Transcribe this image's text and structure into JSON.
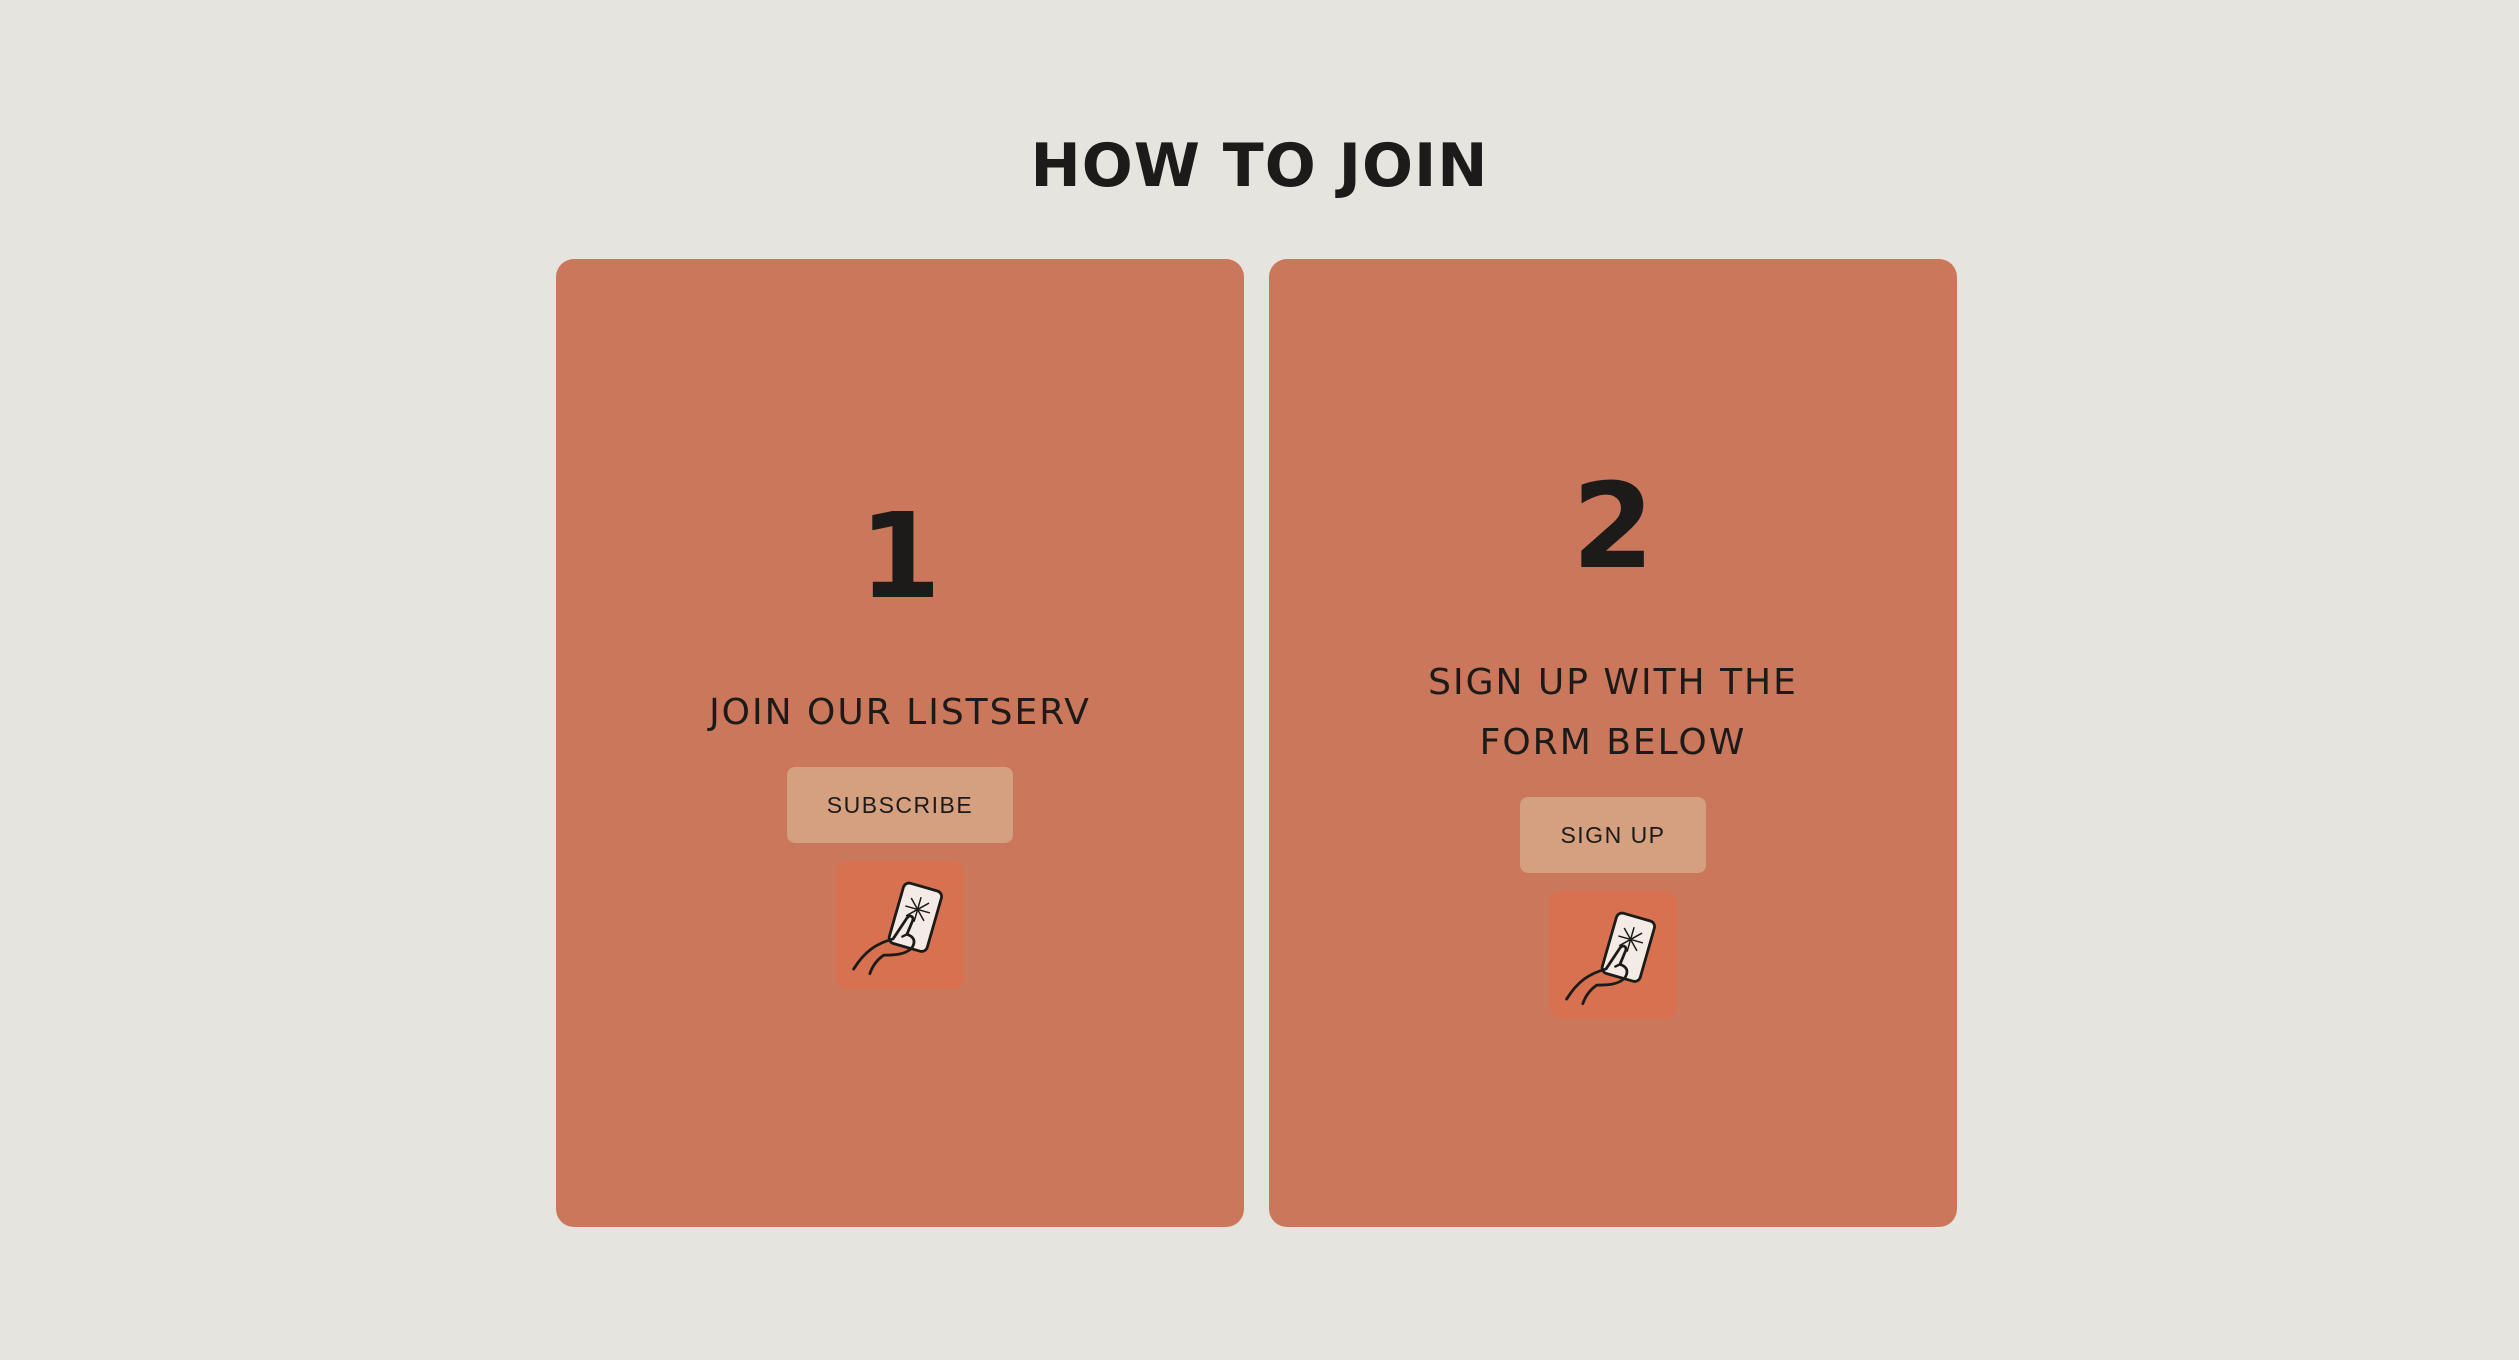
{
  "page": {
    "title": "HOW TO JOIN"
  },
  "steps": [
    {
      "number": "1",
      "text": "JOIN OUR LISTSERV",
      "button_label": "SUBSCRIBE",
      "icon": "hand-tapping-phone-icon"
    },
    {
      "number": "2",
      "text": "SIGN UP WITH THE FORM BELOW",
      "button_label": "SIGN UP",
      "icon": "hand-tapping-phone-icon"
    }
  ],
  "colors": {
    "background": "#e6e4df",
    "card": "#cb775b",
    "button": "#d4a080",
    "icon_tile": "#d8714f",
    "text": "#1c1b19"
  }
}
